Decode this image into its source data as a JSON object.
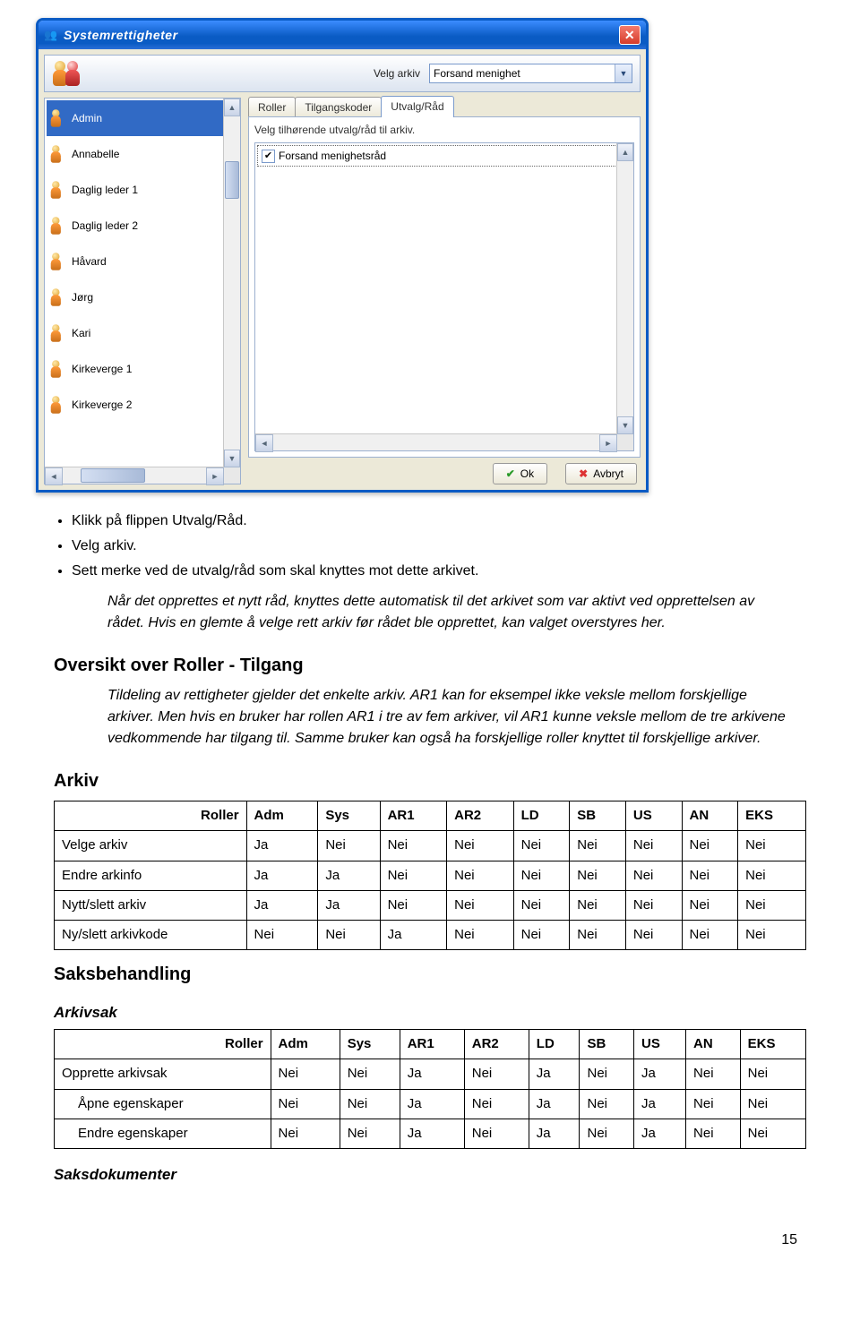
{
  "window": {
    "title": "Systemrettigheter",
    "velg_arkiv_label": "Velg arkiv",
    "velg_arkiv_value": "Forsand menighet",
    "tabs": [
      "Roller",
      "Tilgangskoder",
      "Utvalg/Råd"
    ],
    "active_tab": 2,
    "hint": "Velg tilhørende utvalg/råd til arkiv.",
    "check_item": "Forsand menighetsråd",
    "ok": "Ok",
    "cancel": "Avbryt",
    "users": [
      "Admin",
      "Annabelle",
      "Daglig leder 1",
      "Daglig leder 2",
      "Håvard",
      "Jørg",
      "Kari",
      "Kirkeverge 1",
      "Kirkeverge 2"
    ],
    "selected_user": 0
  },
  "bullets": [
    "Klikk på flippen Utvalg/Råd.",
    "Velg arkiv.",
    "Sett merke ved de utvalg/råd som skal knyttes mot dette arkivet."
  ],
  "note1": "Når det opprettes et nytt råd, knyttes dette automatisk til det arkivet som var aktivt ved opprettelsen av rådet. Hvis en glemte å velge rett arkiv før rådet ble opprettet, kan valget overstyres her.",
  "section_overview": "Oversikt over Roller - Tilgang",
  "note2": "Tildeling av rettigheter gjelder det enkelte arkiv. AR1 kan for eksempel ikke veksle mellom forskjellige arkiver. Men hvis en bruker har rollen AR1 i tre av fem arkiver, vil AR1 kunne veksle mellom de tre arkivene vedkommende har tilgang til. Samme bruker kan også ha forskjellige roller knyttet til forskjellige arkiver.",
  "section_arkiv": "Arkiv",
  "columns": [
    "Roller",
    "Adm",
    "Sys",
    "AR1",
    "AR2",
    "LD",
    "SB",
    "US",
    "AN",
    "EKS"
  ],
  "arkiv_rows": [
    {
      "label": "Velge arkiv",
      "cells": [
        "Ja",
        "Nei",
        "Nei",
        "Nei",
        "Nei",
        "Nei",
        "Nei",
        "Nei",
        "Nei"
      ]
    },
    {
      "label": "Endre arkinfo",
      "cells": [
        "Ja",
        "Ja",
        "Nei",
        "Nei",
        "Nei",
        "Nei",
        "Nei",
        "Nei",
        "Nei"
      ]
    },
    {
      "label": "Nytt/slett arkiv",
      "cells": [
        "Ja",
        "Ja",
        "Nei",
        "Nei",
        "Nei",
        "Nei",
        "Nei",
        "Nei",
        "Nei"
      ]
    },
    {
      "label": "Ny/slett arkivkode",
      "cells": [
        "Nei",
        "Nei",
        "Ja",
        "Nei",
        "Nei",
        "Nei",
        "Nei",
        "Nei",
        "Nei"
      ]
    }
  ],
  "section_saksb": "Saksbehandling",
  "sub_arkivsak": "Arkivsak",
  "arkivsak_rows": [
    {
      "label": "Opprette arkivsak",
      "cells": [
        "Nei",
        "Nei",
        "Ja",
        "Nei",
        "Ja",
        "Nei",
        "Ja",
        "Nei",
        "Nei"
      ],
      "sub": false
    },
    {
      "label": "Åpne egenskaper",
      "cells": [
        "Nei",
        "Nei",
        "Ja",
        "Nei",
        "Ja",
        "Nei",
        "Ja",
        "Nei",
        "Nei"
      ],
      "sub": true
    },
    {
      "label": "Endre egenskaper",
      "cells": [
        "Nei",
        "Nei",
        "Ja",
        "Nei",
        "Ja",
        "Nei",
        "Ja",
        "Nei",
        "Nei"
      ],
      "sub": true
    }
  ],
  "sub_saksdokumenter": "Saksdokumenter",
  "page_number": "15"
}
